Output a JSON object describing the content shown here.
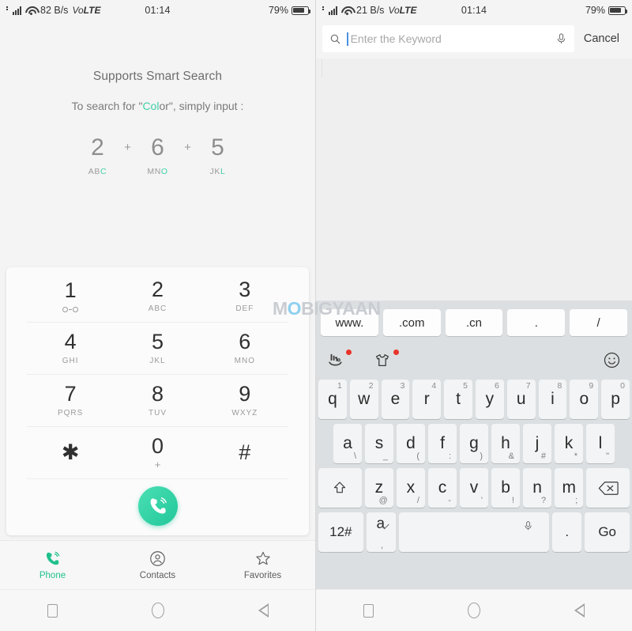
{
  "left": {
    "statusbar": {
      "network_speed": "82 B/s",
      "volte": "VoLTE",
      "time": "01:14",
      "battery": "79%"
    },
    "smart_search": {
      "title": "Supports Smart Search",
      "sub_prefix": "To search for \"",
      "sub_highlight": "Col",
      "sub_mid": "or\", simply input :",
      "digits": [
        {
          "num": "2",
          "letters_plain": "AB",
          "letters_hl": "C"
        },
        {
          "num": "6",
          "letters_plain": "MN",
          "letters_hl": "O"
        },
        {
          "num": "5",
          "letters_plain": "JK",
          "letters_hl": "L"
        }
      ],
      "plus": "+"
    },
    "dialpad": {
      "keys": [
        {
          "num": "1",
          "sub": "",
          "icon": "voicemail-icon"
        },
        {
          "num": "2",
          "sub": "ABC",
          "icon": ""
        },
        {
          "num": "3",
          "sub": "DEF",
          "icon": ""
        },
        {
          "num": "4",
          "sub": "GHI",
          "icon": ""
        },
        {
          "num": "5",
          "sub": "JKL",
          "icon": ""
        },
        {
          "num": "6",
          "sub": "MNO",
          "icon": ""
        },
        {
          "num": "7",
          "sub": "PQRS",
          "icon": ""
        },
        {
          "num": "8",
          "sub": "TUV",
          "icon": ""
        },
        {
          "num": "9",
          "sub": "WXYZ",
          "icon": ""
        },
        {
          "num": "✱",
          "sub": "",
          "icon": ""
        },
        {
          "num": "0",
          "sub": "+",
          "icon": ""
        },
        {
          "num": "#",
          "sub": "",
          "icon": ""
        }
      ],
      "call_button": "call-icon"
    },
    "tabbar": [
      {
        "label": "Phone",
        "icon": "phone-icon",
        "active": true
      },
      {
        "label": "Contacts",
        "icon": "contact-icon",
        "active": false
      },
      {
        "label": "Favorites",
        "icon": "star-icon",
        "active": false
      }
    ]
  },
  "right": {
    "statusbar": {
      "network_speed": "21 B/s",
      "volte": "VoLTE",
      "time": "01:14",
      "battery": "79%"
    },
    "search": {
      "placeholder": "Enter the Keyword",
      "value": "",
      "search_icon": "search-icon",
      "mic_icon": "microphone-icon",
      "cancel_label": "Cancel"
    },
    "keyboard": {
      "suggestions": [
        "www.",
        ".com",
        ".cn",
        ".",
        "/"
      ],
      "toolbar": {
        "input_method_icon": "handwriting-input-icon",
        "theme_icon": "tshirt-theme-icon",
        "emoji_icon": "emoji-smiley-icon"
      },
      "row1": [
        {
          "main": "q",
          "hint": "1"
        },
        {
          "main": "w",
          "hint": "2"
        },
        {
          "main": "e",
          "hint": "3"
        },
        {
          "main": "r",
          "hint": "4"
        },
        {
          "main": "t",
          "hint": "5"
        },
        {
          "main": "y",
          "hint": "6"
        },
        {
          "main": "u",
          "hint": "7"
        },
        {
          "main": "i",
          "hint": "8"
        },
        {
          "main": "o",
          "hint": "9"
        },
        {
          "main": "p",
          "hint": "0"
        }
      ],
      "row2": [
        {
          "main": "a",
          "alt": "\\"
        },
        {
          "main": "s",
          "alt": "_"
        },
        {
          "main": "d",
          "alt": "("
        },
        {
          "main": "f",
          "alt": ":"
        },
        {
          "main": "g",
          "alt": ")"
        },
        {
          "main": "h",
          "alt": "&"
        },
        {
          "main": "j",
          "alt": "#"
        },
        {
          "main": "k",
          "alt": "*"
        },
        {
          "main": "l",
          "alt": "\""
        }
      ],
      "row3": [
        {
          "main": "z",
          "alt": "@"
        },
        {
          "main": "x",
          "alt": "/"
        },
        {
          "main": "c",
          "alt": "-"
        },
        {
          "main": "v",
          "alt": "'"
        },
        {
          "main": "b",
          "alt": "!"
        },
        {
          "main": "n",
          "alt": "?"
        },
        {
          "main": "m",
          "alt": ";"
        }
      ],
      "shift_icon": "shift-up-icon",
      "backspace_icon": "backspace-icon",
      "row4": {
        "numeric_label": "12#",
        "lang_label": "a",
        "lang_alt": ",",
        "space_mic_icon": "microphone-icon",
        "dot_label": ".",
        "go_label": "Go"
      }
    }
  },
  "watermark": {
    "part1": "M",
    "part_o": "O",
    "part2": "BIGYAAN"
  },
  "colors": {
    "accent_teal": "#1fc08c",
    "highlight_teal": "#3fd0a8",
    "caret_blue": "#4a90e2",
    "badge_red": "#e8342a",
    "keyboard_bg": "#dcdfe1"
  }
}
